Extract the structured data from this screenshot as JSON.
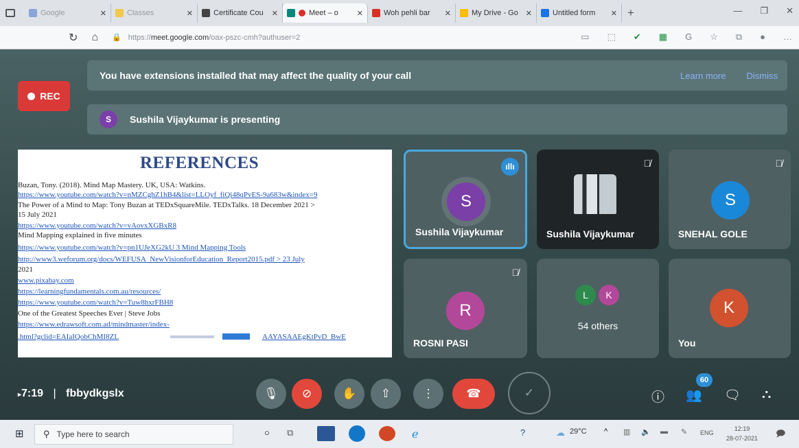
{
  "browser": {
    "tabs": [
      {
        "label": "Google",
        "color": "#8aa6d8"
      },
      {
        "label": "Classes",
        "color": "#f2c94c"
      },
      {
        "label": "Certificate Cou",
        "color": "#444444"
      },
      {
        "label": "Meet – o",
        "color": "#00897b"
      },
      {
        "label": "Woh pehli bar",
        "color": "#d93025"
      },
      {
        "label": "My Drive - Go",
        "color": "#fbbc04"
      },
      {
        "label": "Untitled form",
        "color": "#1a73e8"
      }
    ],
    "new_tab_label": "+",
    "url_domain": "meet.google.com",
    "url_prefix": "https://",
    "url_suffix": "/oax-pszc-cmh?authuser=2"
  },
  "meet": {
    "extension_banner": {
      "text": "You have extensions installed that may affect the quality of your call",
      "learn_more": "Learn more",
      "dismiss": "Dismiss"
    },
    "rec_label": "REC",
    "presenting": {
      "initial": "S",
      "text": "Sushila Vijaykumar is presenting"
    },
    "slide": {
      "title": "REFERENCES",
      "lines": [
        {
          "text": "Buzan, Tony. (2018). Mind Map Mastery.  UK, USA: Watkins.",
          "link": false
        },
        {
          "text": "https://www.youtube.com/watch?v=nMZCghZ1hB4&list=LLOyf_fiQi48qPvES-9a683w&index=9",
          "link": true
        },
        {
          "text": "The Power of a Mind to Map: Tony Buzan at TEDxSquareMile. TEDxTalks. 18 December 2021 >",
          "link": false
        },
        {
          "text": "15 July 2021",
          "link": false
        },
        {
          "text": "https://www.youtube.com/watch?v=vAovxXGBxR8",
          "link": true
        },
        {
          "text": "Mind Mapping explained in five minutes",
          "link": false
        },
        {
          "text": "https://www.youtube.com/watch?v=pn1UJeXG2kU 3 Mind Mapping Tools",
          "link": true
        },
        {
          "text": "http://www3.weforum.org/docs/WEFUSA_NewVisionforEducation_Report2015.pdf  >  23  July",
          "link": true
        },
        {
          "text": "2021",
          "link": false
        },
        {
          "text": "www.pixabay.com",
          "link": true
        },
        {
          "text": "https://learningfundamentals.com.au/resources/",
          "link": true
        },
        {
          "text": "https://www.youtube.com/watch?v=Tuw8hxrFBH8",
          "link": true
        },
        {
          "text": "One of the Greatest Speeches Ever | Steve Jobs",
          "link": false
        },
        {
          "text": "https://www.edrawsoft.com.ad/mindmaster/index-",
          "link": true
        },
        {
          "text": ".html?gclid=EAIaIQobChMI8ZL",
          "link": true
        }
      ],
      "last_line_tail": "AAYASAAEgKtPvD_BwE"
    },
    "participants": [
      {
        "name": "Sushila Vijaykumar",
        "initial": "S",
        "avatar_color": "#7b3fa8",
        "speaking": true
      },
      {
        "name": "Sushila Vijaykumar",
        "initial": "",
        "video": true,
        "muted": true
      },
      {
        "name": "SNEHAL GOLE",
        "initial": "S",
        "avatar_color": "#1a88d8",
        "muted": true
      },
      {
        "name": "ROSNI PASI",
        "initial": "R",
        "avatar_color": "#b3489a",
        "muted": true
      },
      {
        "name": "54 others",
        "initials": [
          "L",
          "K"
        ],
        "initial_colors": [
          "#2f8a4e",
          "#b3489a"
        ]
      },
      {
        "name": "You",
        "initial": "K",
        "avatar_color": "#d2512f"
      }
    ],
    "controls": {
      "time": "7:19",
      "separator": "|",
      "meeting_code": "fbbydkgslx",
      "people_count": "60"
    },
    "colors": {
      "rec_red": "#d93a38",
      "end_call_red": "#e2473b",
      "active_border": "#4aa8e0"
    }
  },
  "taskbar": {
    "search_placeholder": "Type here to search",
    "weather": "29°C",
    "language": "ENG",
    "clock_time": "12:19",
    "clock_date": "28-07-2021"
  }
}
